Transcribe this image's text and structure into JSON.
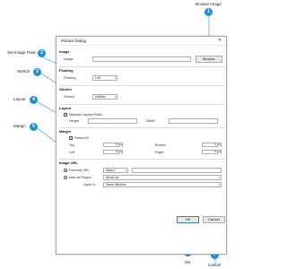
{
  "callouts": [
    {
      "num": "1",
      "label": "Browse Image"
    },
    {
      "num": "2",
      "label": "Set Image Float"
    },
    {
      "num": "3",
      "label": "Stretch"
    },
    {
      "num": "4",
      "label": "Layout"
    },
    {
      "num": "5",
      "label": "Margin"
    },
    {
      "num": "6",
      "label": "OK"
    },
    {
      "num": "7",
      "label": "Cancel"
    }
  ],
  "dialog": {
    "title": "Picture Dialog",
    "close": "✕",
    "image": {
      "section": "Image",
      "label": "Image",
      "value": "",
      "browse": "Browse"
    },
    "floating": {
      "section": "Floating",
      "label": "Floating",
      "value": "Left"
    },
    "stretch": {
      "section": "Stretch",
      "label": "Stretch",
      "value": "Uniform"
    },
    "layout": {
      "section": "Layout",
      "maintain": "Maintain Aspect Ratio",
      "maintain_checked": true,
      "height_label": "Height",
      "height": "",
      "width_label": "Width",
      "width": ""
    },
    "margin": {
      "section": "Margin",
      "select_all": "Select All",
      "select_all_checked": true,
      "top_label": "Top",
      "top": "0",
      "bottom_label": "Bottom",
      "bottom": "0",
      "left_label": "Left",
      "left": "0",
      "right_label": "Right",
      "right": "0"
    },
    "url": {
      "section": "Image URL",
      "external_label": "External URL",
      "external_selected": true,
      "protocol": "https://",
      "external_value": "",
      "internal_label": "Internal Pages",
      "internal_value": "About Us",
      "open_in_label": "Open In",
      "open_in_value": "Same Window"
    },
    "ok": "OK",
    "cancel": "Cancel"
  },
  "colors": {
    "accent": "#1f8fd6"
  }
}
